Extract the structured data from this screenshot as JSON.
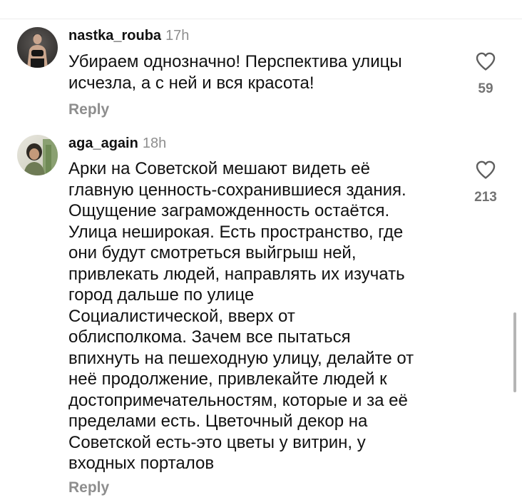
{
  "comments": [
    {
      "username": "nastka_rouba",
      "time": "17h",
      "lines": [
        "Убираем однозначно! Перспектива улицы",
        "исчезла, а с ней и вся красота!"
      ],
      "likes": "59",
      "reply_label": "Reply",
      "avatar_icon": "avatar-photo"
    },
    {
      "username": "aga_again",
      "time": "18h",
      "lines": [
        "Арки на Советской  мешают видеть её",
        "главную ценность-сохранившиеся здания.",
        "Ощущение заграможденность остаётся.",
        "Улица неширокая.  Есть пространство, где",
        "они будут смотреться выйгрыш ней,",
        "привлекать людей, направлять их изучать",
        "город дальше по улице",
        "Социалистической, вверх от",
        "облисполкома. Зачем все пытаться",
        "впихнуть на пешеходную улицу, делайте от",
        "неё продолжение, привлекайте людей к",
        "достопримечательностям, которые и за её",
        "пределами есть.  Цветочный декор на",
        "Советской есть-это цветы у витрин, у",
        "входных порталов"
      ],
      "likes": "213",
      "reply_label": "Reply",
      "avatar_icon": "avatar-photo"
    }
  ],
  "icons": {
    "like": "heart-outline-icon"
  }
}
